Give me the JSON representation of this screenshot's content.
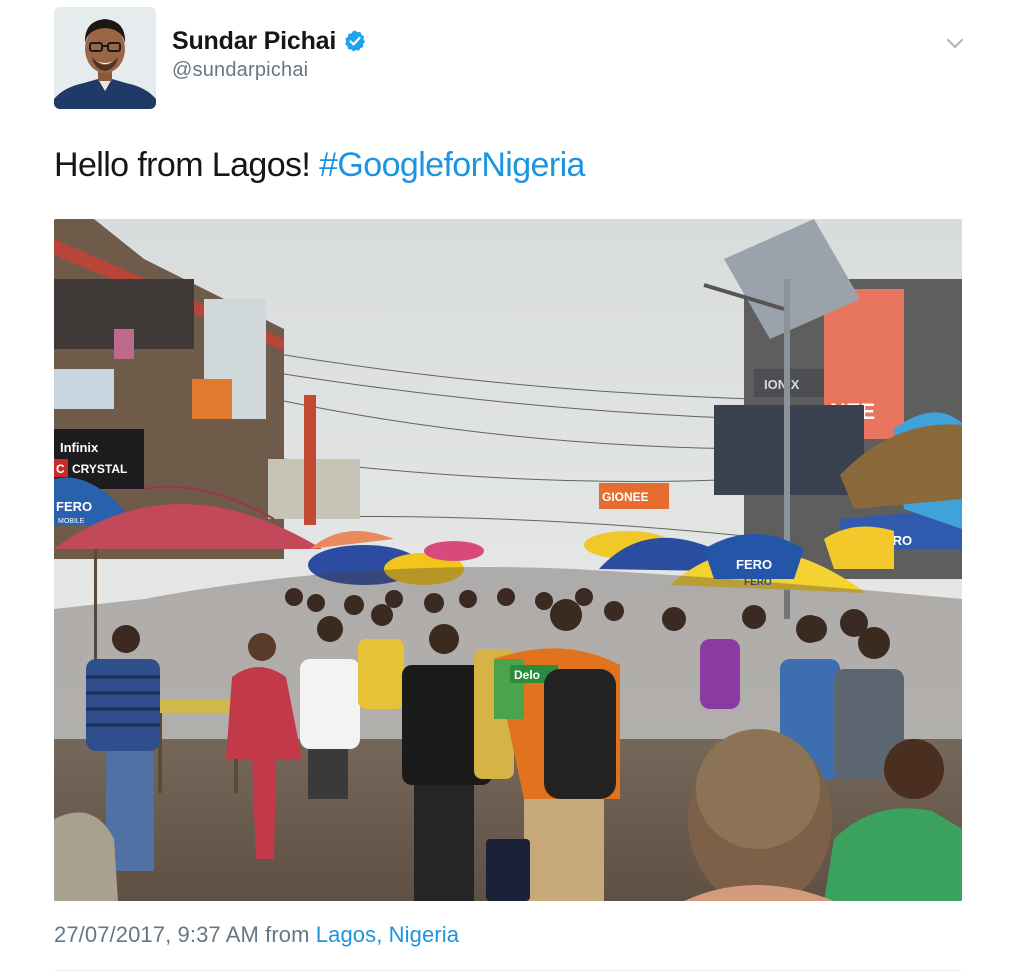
{
  "author": {
    "display_name": "Sundar Pichai",
    "handle": "@sundarpichai",
    "verified": true,
    "avatar_icon": "profile-photo",
    "verified_icon": "verified-badge-icon"
  },
  "menu": {
    "icon": "chevron-down-icon"
  },
  "tweet": {
    "text_plain": "Hello from Lagos! ",
    "hashtag": "#GoogleforNigeria"
  },
  "media": {
    "type": "photo",
    "scene": "crowded-street-market-icon",
    "signs": {
      "fero_left": "FERO",
      "fero_left_sub": "MOBILE",
      "infinix": "Infinix",
      "crystal": "CRYSTAL",
      "crystal_short": "C",
      "gionee": "GIONEE",
      "gionee_partial": "NEE",
      "fero_umbrella": "FERO",
      "fero_umbrella_2": "FERO",
      "fero_right": "FERO",
      "delo": "Delo",
      "tablet_sign": "IONIX"
    }
  },
  "meta": {
    "datetime": "27/07/2017, 9:37 AM",
    "from_label": " from ",
    "location": "Lagos, Nigeria"
  },
  "colors": {
    "link": "#1b95e0",
    "secondary_text": "#657786",
    "primary_text": "#14171a",
    "verified": "#1da1f2"
  }
}
